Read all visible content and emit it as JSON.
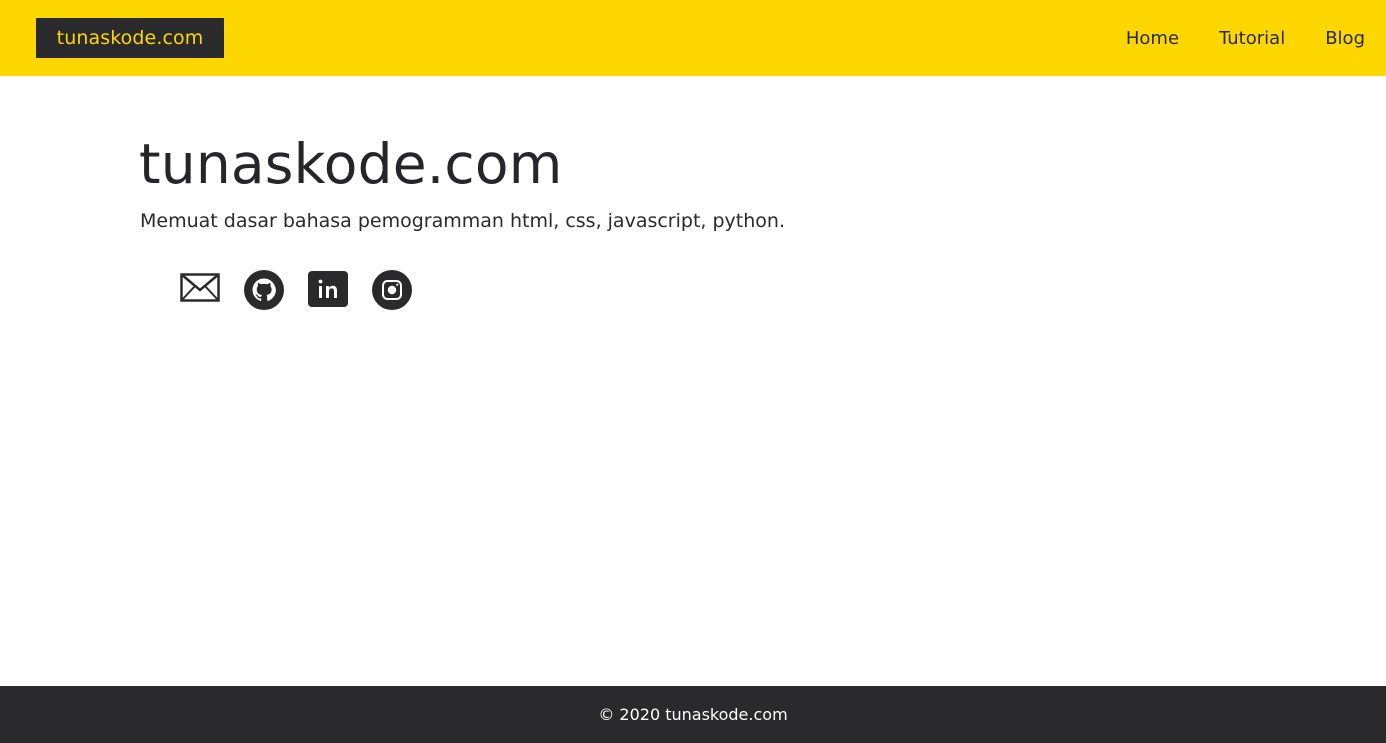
{
  "header": {
    "brand": "tunaskode.com",
    "nav": [
      {
        "label": "Home"
      },
      {
        "label": "Tutorial"
      },
      {
        "label": "Blog"
      }
    ]
  },
  "hero": {
    "title": "tunaskode.com",
    "subtitle": "Memuat dasar bahasa pemogramman html, css, javascript, python."
  },
  "social": [
    {
      "icon": "mail-icon"
    },
    {
      "icon": "github-icon"
    },
    {
      "icon": "linkedin-icon"
    },
    {
      "icon": "instagram-icon"
    }
  ],
  "footer": {
    "text": "© 2020 tunaskode.com"
  },
  "colors": {
    "header_bg": "#ffd700",
    "dark": "#2a2a2c",
    "page_bg": "#ffffff"
  }
}
